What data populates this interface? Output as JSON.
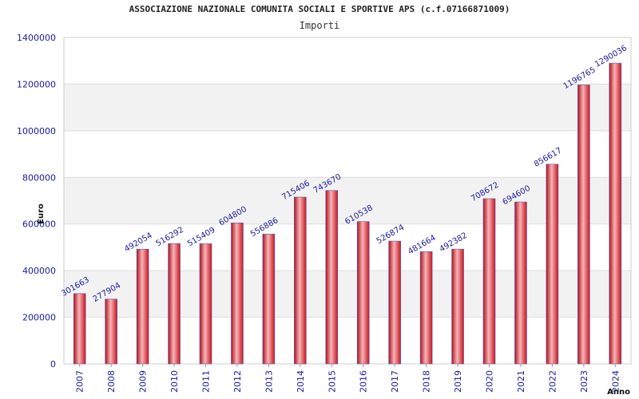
{
  "title": "ASSOCIAZIONE NAZIONALE COMUNITA SOCIALI E SPORTIVE APS (c.f.07166871009)",
  "subtitle": "Importi",
  "colors": {
    "bar": "#e8202a",
    "bar_highlight": "#f7b5b8",
    "label": "#1a1aa0",
    "band": "#f2f2f2"
  },
  "chart_data": {
    "type": "bar",
    "title": "ASSOCIAZIONE NAZIONALE COMUNITA SOCIALI E SPORTIVE APS (c.f.07166871009)",
    "subtitle": "Importi",
    "xlabel": "Anno",
    "ylabel": "Euro",
    "ylim": [
      0,
      1400000
    ],
    "yticks": [
      "0",
      "200000",
      "400000",
      "600000",
      "800000",
      "1000000",
      "1200000",
      "1400000"
    ],
    "categories": [
      "2007",
      "2008",
      "2009",
      "2010",
      "2011",
      "2012",
      "2013",
      "2014",
      "2015",
      "2016",
      "2017",
      "2018",
      "2019",
      "2020",
      "2021",
      "2022",
      "2023",
      "2024"
    ],
    "values": [
      301663,
      277904,
      492054,
      516292,
      515409,
      604800,
      556886,
      715406,
      743670,
      610538,
      526874,
      481664,
      492382,
      708672,
      694600,
      856617,
      1196765,
      1290036
    ],
    "grid": "horizontal alternating bands",
    "legend": "none"
  }
}
